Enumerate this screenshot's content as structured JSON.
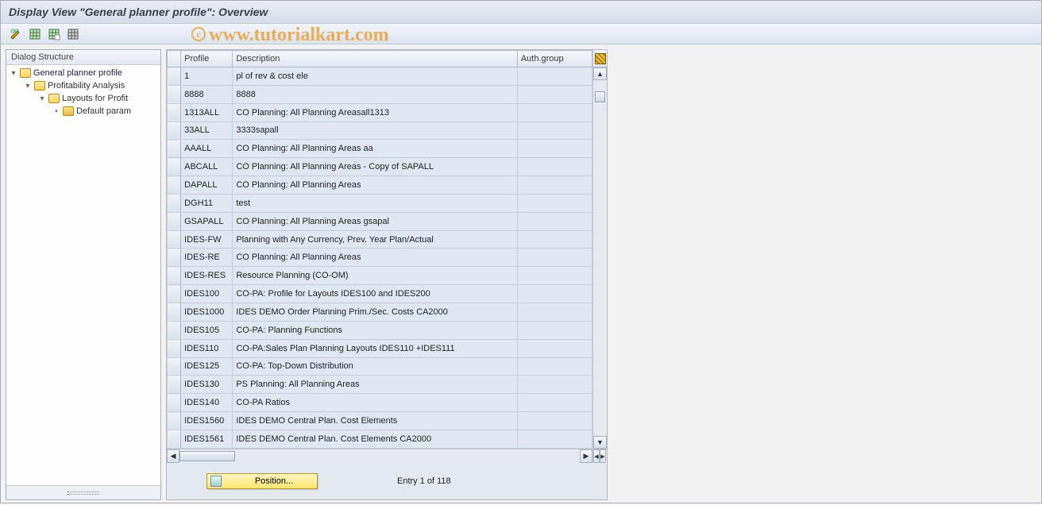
{
  "title": "Display View \"General planner profile\": Overview",
  "watermark": "www.tutorialkart.com",
  "tree": {
    "header": "Dialog Structure",
    "nodes": [
      {
        "level": 1,
        "open": true,
        "label": "General planner profile"
      },
      {
        "level": 2,
        "open": true,
        "label": "Profitability Analysis"
      },
      {
        "level": 3,
        "open": true,
        "label": "Layouts for Profit"
      },
      {
        "level": 4,
        "open": false,
        "label": "Default param"
      }
    ]
  },
  "grid": {
    "columns": {
      "profile": "Profile",
      "description": "Description",
      "auth_group": "Auth.group"
    },
    "rows": [
      {
        "profile": "1",
        "description": "pl of rev & cost ele",
        "auth": ""
      },
      {
        "profile": "8888",
        "description": "8888",
        "auth": ""
      },
      {
        "profile": "1313ALL",
        "description": "CO Planning: All Planning Areasall1313",
        "auth": ""
      },
      {
        "profile": "33ALL",
        "description": "3333sapall",
        "auth": ""
      },
      {
        "profile": "AAALL",
        "description": "CO Planning: All Planning Areas aa",
        "auth": ""
      },
      {
        "profile": "ABCALL",
        "description": "CO Planning: All Planning Areas - Copy of SAPALL",
        "auth": ""
      },
      {
        "profile": "DAPALL",
        "description": "CO Planning: All Planning Areas",
        "auth": ""
      },
      {
        "profile": "DGH11",
        "description": "test",
        "auth": ""
      },
      {
        "profile": "GSAPALL",
        "description": "CO Planning: All Planning Areas gsapal",
        "auth": ""
      },
      {
        "profile": "IDES-FW",
        "description": "Planning with Any Currency, Prev. Year Plan/Actual",
        "auth": ""
      },
      {
        "profile": "IDES-RE",
        "description": "CO Planning: All Planning Areas",
        "auth": ""
      },
      {
        "profile": "IDES-RES",
        "description": "Resource Planning (CO-OM)",
        "auth": ""
      },
      {
        "profile": "IDES100",
        "description": "CO-PA: Profile for Layouts IDES100 and IDES200",
        "auth": ""
      },
      {
        "profile": "IDES1000",
        "description": "IDES DEMO Order Planning Prim./Sec. Costs   CA2000",
        "auth": ""
      },
      {
        "profile": "IDES105",
        "description": "CO-PA: Planning Functions",
        "auth": ""
      },
      {
        "profile": "IDES110",
        "description": "CO-PA:Sales Plan Planning Layouts IDES110 +IDES111",
        "auth": ""
      },
      {
        "profile": "IDES125",
        "description": "CO-PA: Top-Down Distribution",
        "auth": ""
      },
      {
        "profile": "IDES130",
        "description": "PS Planning: All Planning Areas",
        "auth": ""
      },
      {
        "profile": "IDES140",
        "description": "CO-PA Ratios",
        "auth": ""
      },
      {
        "profile": "IDES1560",
        "description": "IDES DEMO Central Plan. Cost Elements",
        "auth": ""
      },
      {
        "profile": "IDES1561",
        "description": "IDES DEMO Central Plan. Cost Elements      CA2000",
        "auth": ""
      }
    ]
  },
  "footer": {
    "position_label": "Position...",
    "entry_text": "Entry 1 of 118"
  }
}
